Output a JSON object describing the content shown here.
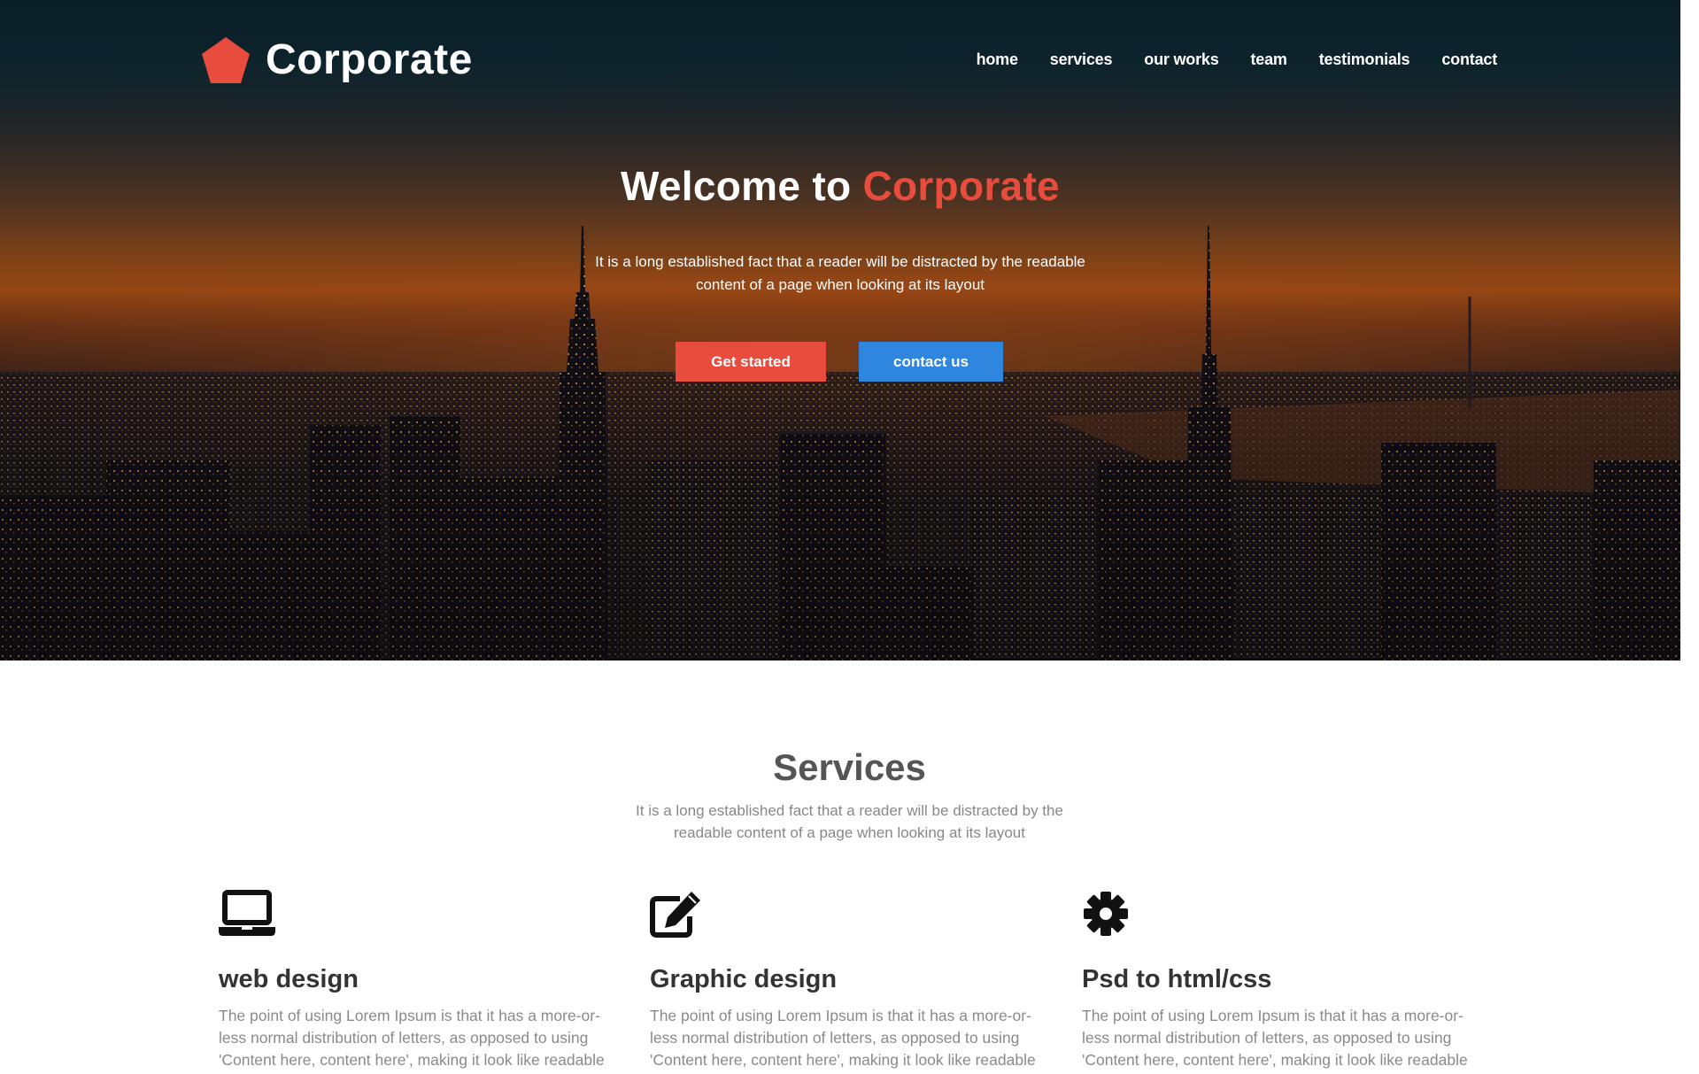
{
  "brand": {
    "name": "Corporate",
    "logo_icon": "pentagon-logo-icon",
    "accent_color": "#e74c3c"
  },
  "nav": {
    "items": [
      {
        "label": "home"
      },
      {
        "label": "services"
      },
      {
        "label": "our works"
      },
      {
        "label": "team"
      },
      {
        "label": "testimonials"
      },
      {
        "label": "contact"
      }
    ]
  },
  "hero": {
    "title_prefix": "Welcome to ",
    "title_accent": "Corporate",
    "subtitle_line1": "It is a long established fact that a reader will be distracted by the readable",
    "subtitle_line2": "content of a page when looking at its layout",
    "primary_button": {
      "label": "Get started",
      "color": "#e74c3c"
    },
    "secondary_button": {
      "label": "contact us",
      "color": "#2e86de"
    }
  },
  "services": {
    "title": "Services",
    "subtitle_line1": "It is a long established fact that a reader will be distracted by the",
    "subtitle_line2": "readable content of a page when looking at its layout",
    "items": [
      {
        "icon": "laptop-icon",
        "title": "web design",
        "text": "The point of using Lorem Ipsum is that it has a more-or-less normal distribution of letters, as opposed to using 'Content here, content here', making it look like readable English."
      },
      {
        "icon": "edit-icon",
        "title": "Graphic design",
        "text": "The point of using Lorem Ipsum is that it has a more-or-less normal distribution of letters, as opposed to using 'Content here, content here', making it look like readable English."
      },
      {
        "icon": "gear-icon",
        "title": "Psd to html/css",
        "text": "The point of using Lorem Ipsum is that it has a more-or-less normal distribution of letters, as opposed to using 'Content here, content here', making it look like readable English."
      }
    ]
  }
}
